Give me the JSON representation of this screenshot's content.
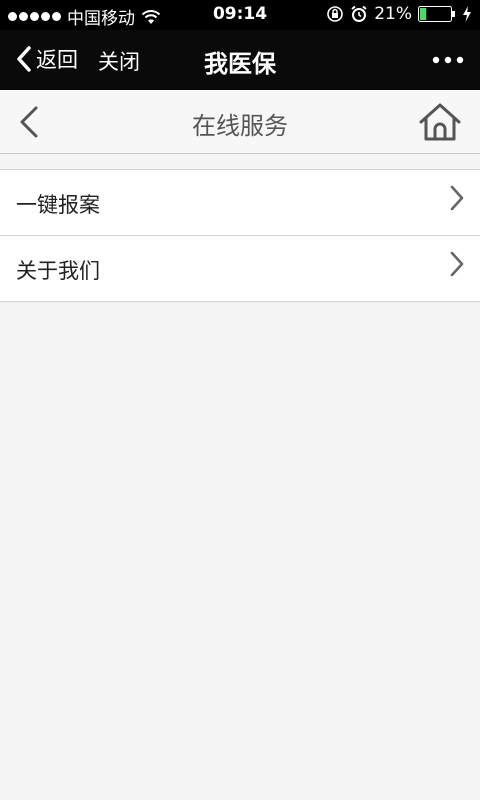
{
  "status_bar": {
    "carrier": "中国移动",
    "time": "09:14",
    "battery_percent": "21%",
    "battery_level": 0.21
  },
  "top_nav": {
    "back_label": "返回",
    "close_label": "关闭",
    "title": "我医保"
  },
  "sub_header": {
    "title": "在线服务"
  },
  "menu": {
    "items": [
      {
        "label": "一键报案"
      },
      {
        "label": "关于我们"
      }
    ]
  },
  "colors": {
    "nav_bg": "#0a0a0a",
    "page_bg": "#f4f4f4",
    "battery_fill": "#4cd964"
  }
}
